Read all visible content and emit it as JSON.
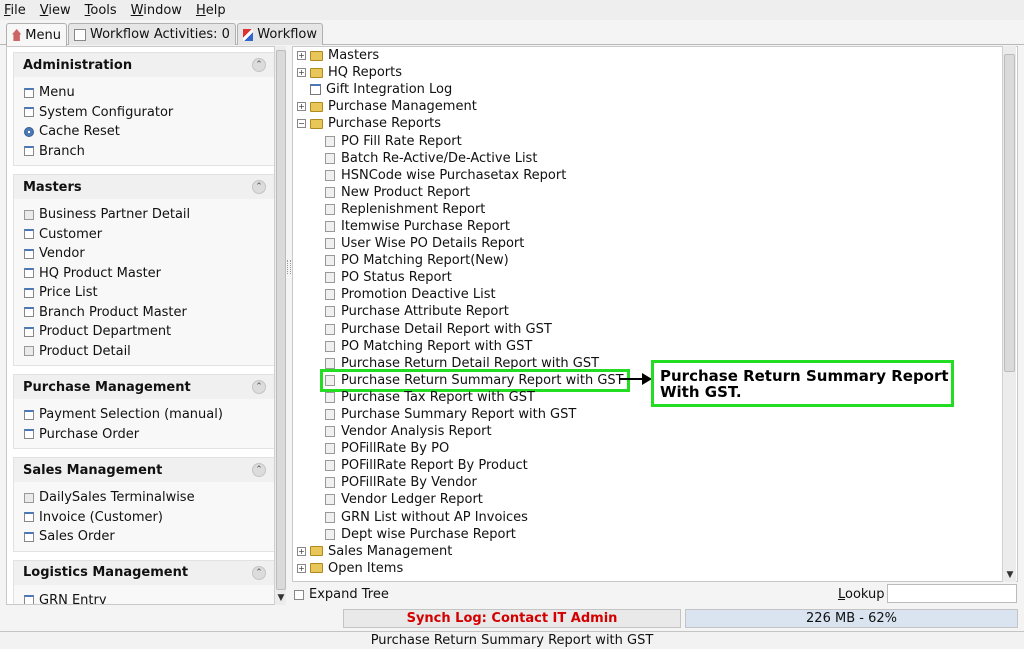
{
  "menubar": [
    "File",
    "View",
    "Tools",
    "Window",
    "Help"
  ],
  "tabs": {
    "menu": "Menu",
    "workflow_activities": "Workflow Activities: 0",
    "workflow": "Workflow"
  },
  "left_groups": [
    {
      "title": "Administration",
      "items": [
        {
          "label": "Menu",
          "icon": "doc-icon"
        },
        {
          "label": "System Configurator",
          "icon": "doc-icon"
        },
        {
          "label": "Cache Reset",
          "icon": "gear-icon"
        },
        {
          "label": "Branch",
          "icon": "doc-icon"
        }
      ]
    },
    {
      "title": "Masters",
      "items": [
        {
          "label": "Business Partner Detail",
          "icon": "page-icon"
        },
        {
          "label": "Customer",
          "icon": "doc-icon"
        },
        {
          "label": "Vendor",
          "icon": "doc-icon"
        },
        {
          "label": "HQ Product Master",
          "icon": "doc-icon"
        },
        {
          "label": "Price List",
          "icon": "doc-icon"
        },
        {
          "label": "Branch Product Master",
          "icon": "doc-icon"
        },
        {
          "label": "Product Department",
          "icon": "doc-icon"
        },
        {
          "label": "Product Detail",
          "icon": "page-icon"
        }
      ]
    },
    {
      "title": "Purchase Management",
      "items": [
        {
          "label": "Payment Selection (manual)",
          "icon": "doc-icon"
        },
        {
          "label": "Purchase Order",
          "icon": "doc-icon"
        }
      ]
    },
    {
      "title": "Sales Management",
      "items": [
        {
          "label": "DailySales Terminalwise",
          "icon": "page-icon"
        },
        {
          "label": "Invoice (Customer)",
          "icon": "doc-icon"
        },
        {
          "label": "Sales Order",
          "icon": "doc-icon"
        }
      ]
    },
    {
      "title": "Logistics Management",
      "items": [
        {
          "label": "GRN Entry",
          "icon": "doc-icon"
        }
      ]
    }
  ],
  "tree": {
    "top": [
      {
        "label": "Masters",
        "type": "folder",
        "expander": "+"
      },
      {
        "label": "HQ Reports",
        "type": "folder",
        "expander": "+"
      },
      {
        "label": "Gift Integration Log",
        "type": "leaf",
        "expander": ""
      },
      {
        "label": "Purchase Management",
        "type": "folder",
        "expander": "+"
      },
      {
        "label": "Purchase Reports",
        "type": "folder-open",
        "expander": "-"
      }
    ],
    "purchase_reports": [
      "PO Fill Rate Report",
      "Batch Re-Active/De-Active List",
      "HSNCode wise Purchasetax Report",
      "New Product Report",
      "Replenishment Report",
      "Itemwise Purchase Report",
      "User Wise PO Details Report",
      "PO Matching Report(New)",
      "PO Status Report",
      "Promotion Deactive List",
      "Purchase Attribute Report",
      "Purchase Detail Report with GST",
      "PO Matching Report with GST",
      "Purchase Return Detail Report with GST",
      "Purchase Return Summary Report with GST",
      "Purchase Tax Report with GST",
      "Purchase Summary Report with GST",
      "Vendor Analysis Report",
      "POFillRate By PO",
      "POFillRate Report By Product",
      "POFillRate By Vendor",
      "Vendor Ledger Report",
      "GRN List without AP Invoices",
      "Dept wise Purchase Report"
    ],
    "bottom": [
      {
        "label": "Sales Management",
        "type": "folder",
        "expander": "+"
      },
      {
        "label": "Open Items",
        "type": "folder",
        "expander": "+"
      }
    ],
    "highlighted": "Purchase Return Summary Report with GST"
  },
  "annotation": {
    "line1": "Purchase Return Summary Report",
    "line2": "With GST."
  },
  "bottom": {
    "expand_tree": "Expand Tree",
    "lookup": "Lookup",
    "lookup_value": ""
  },
  "status": {
    "synch_log": "Synch Log: Contact IT Admin",
    "memory": "226 MB - 62%",
    "selected": "Purchase Return Summary Report with GST"
  },
  "colors": {
    "highlight": "#22dd22",
    "synch_text": "#d40000",
    "memory_bg": "#d9e4f0"
  }
}
